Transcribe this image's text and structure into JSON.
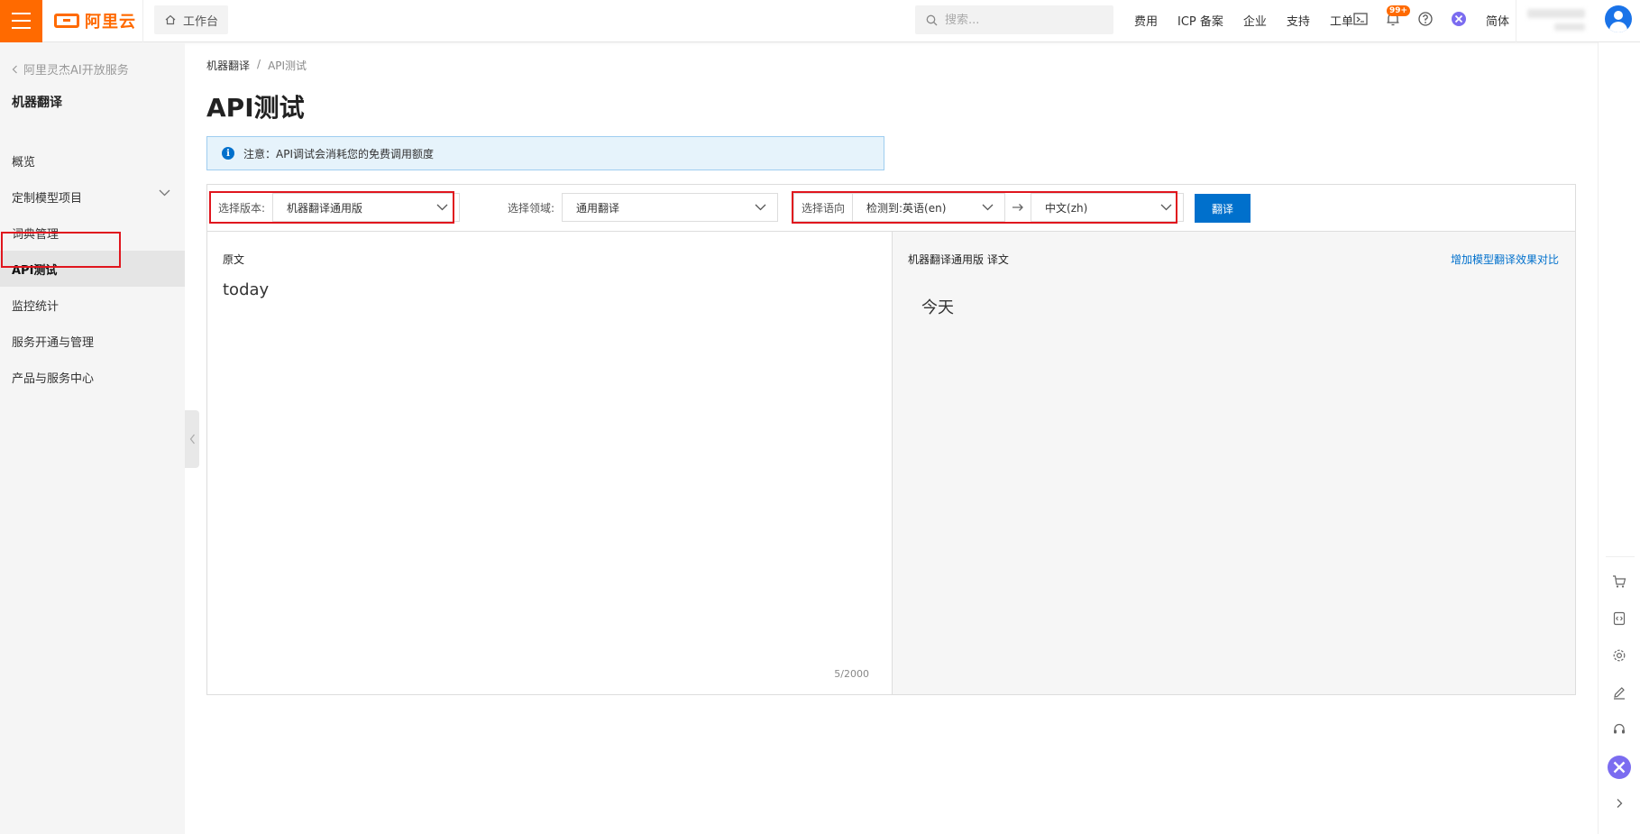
{
  "topbar": {
    "logo_text": "阿里云",
    "workbench_label": "工作台",
    "search_placeholder": "搜索...",
    "links": [
      "费用",
      "ICP 备案",
      "企业",
      "支持",
      "工单"
    ],
    "notification_badge": "99+",
    "language": "简体"
  },
  "sidebar": {
    "back_label": "阿里灵杰AI开放服务",
    "title": "机器翻译",
    "items": [
      {
        "label": "概览"
      },
      {
        "label": "定制模型项目"
      },
      {
        "label": "词典管理"
      },
      {
        "label": "API测试"
      },
      {
        "label": "监控统计"
      },
      {
        "label": "服务开通与管理"
      },
      {
        "label": "产品与服务中心"
      }
    ],
    "active_item": "API测试"
  },
  "breadcrumb": {
    "items": [
      "机器翻译",
      "API测试"
    ],
    "separator": "/"
  },
  "page": {
    "title": "API测试",
    "notice": "注意：API调试会消耗您的免费调用额度"
  },
  "toolbar": {
    "version_label": "选择版本:",
    "version_value": "机器翻译通用版",
    "domain_label": "选择领域:",
    "domain_value": "通用翻译",
    "direction_label": "选择语向",
    "source_lang": "检测到:英语(en)",
    "target_lang": "中文(zh)",
    "translate_button": "翻译"
  },
  "source_pane": {
    "label": "原文",
    "text": "today",
    "counter": "5/2000"
  },
  "target_pane": {
    "label": "机器翻译通用版 译文",
    "compare_link": "增加模型翻译效果对比",
    "text": "今天"
  },
  "colors": {
    "brand": "#ff6a00",
    "primary": "#0070cc",
    "highlight": "#e0161e"
  }
}
